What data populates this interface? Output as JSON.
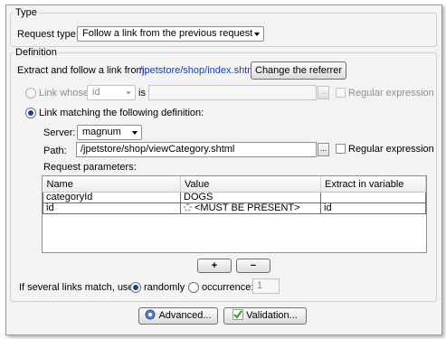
{
  "type_section": {
    "title": "Type",
    "request_type_label": "Request type:",
    "request_type_value": "Follow a link from the previous request"
  },
  "definition": {
    "title": "Definition",
    "extract_label": "Extract and follow a link from:",
    "extract_url": "/jpetstore/shop/index.shtml",
    "change_referrer_label": "Change the referrer",
    "link_whose": {
      "label": "Link whose",
      "field_value": "id",
      "is_label": "is",
      "value_text": "",
      "browse_label": "...",
      "regex_label": "Regular expression"
    },
    "link_matching": {
      "label": "Link matching the following definition:",
      "server_label": "Server:",
      "server_value": "magnum",
      "path_label": "Path:",
      "path_value": "/jpetstore/shop/viewCategory.shtml",
      "browse_label": "...",
      "regex_label": "Regular expression"
    },
    "request_parameters": {
      "title": "Request parameters:",
      "columns": [
        "Name",
        "Value",
        "Extract in variable"
      ],
      "rows": [
        {
          "name": "categoryId",
          "value": "DOGS",
          "extract": ""
        },
        {
          "name": "id",
          "value": "<MUST BE PRESENT>",
          "extract": "id"
        }
      ]
    },
    "add_button_label": "+",
    "remove_button_label": "−",
    "several_links": {
      "label": "If several links match, use:",
      "randomly_label": "randomly",
      "occurrence_label": "occurrence:",
      "occurrence_value": "1"
    }
  },
  "footer": {
    "advanced_label": "Advanced...",
    "validation_label": "Validation..."
  },
  "icons": {
    "advanced": "search-gear-icon",
    "validation": "checkmark-icon",
    "parameter_value": "gear-icon"
  },
  "colors": {
    "link": "#1a3ea8",
    "radio_selected": "#1f3f8f",
    "validation_check": "#2f9b22"
  }
}
